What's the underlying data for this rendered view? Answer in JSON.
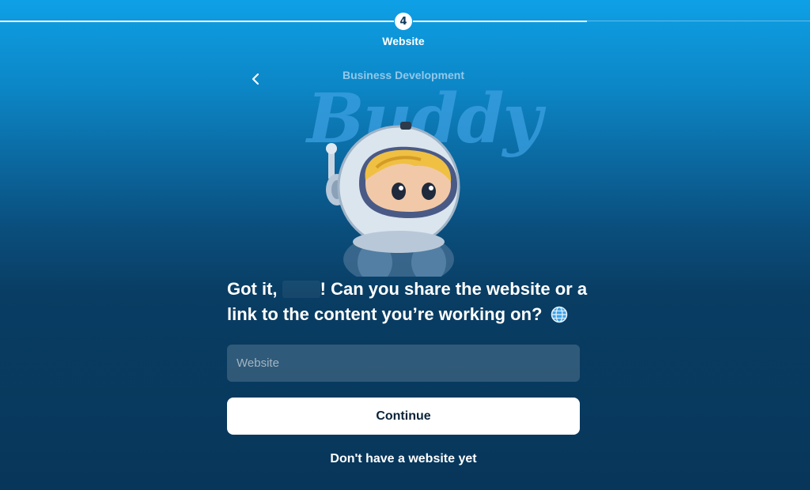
{
  "progress": {
    "step_number": "4",
    "step_label": "Website"
  },
  "brand": {
    "subtitle": "Business Development",
    "script_title": "Buddy"
  },
  "prompt": {
    "part1": "Got it, ",
    "part2": "! Can you share the website or a link to the content you’re working on?"
  },
  "form": {
    "website_placeholder": "Website",
    "continue_label": "Continue"
  },
  "no_website_label": "Don't have a website yet",
  "icons": {
    "back": "chevron-left-icon",
    "globe": "globe-icon"
  },
  "colors": {
    "accent_top": "#0ea0e6",
    "background_bottom": "#08365a",
    "button_bg": "#ffffff"
  }
}
